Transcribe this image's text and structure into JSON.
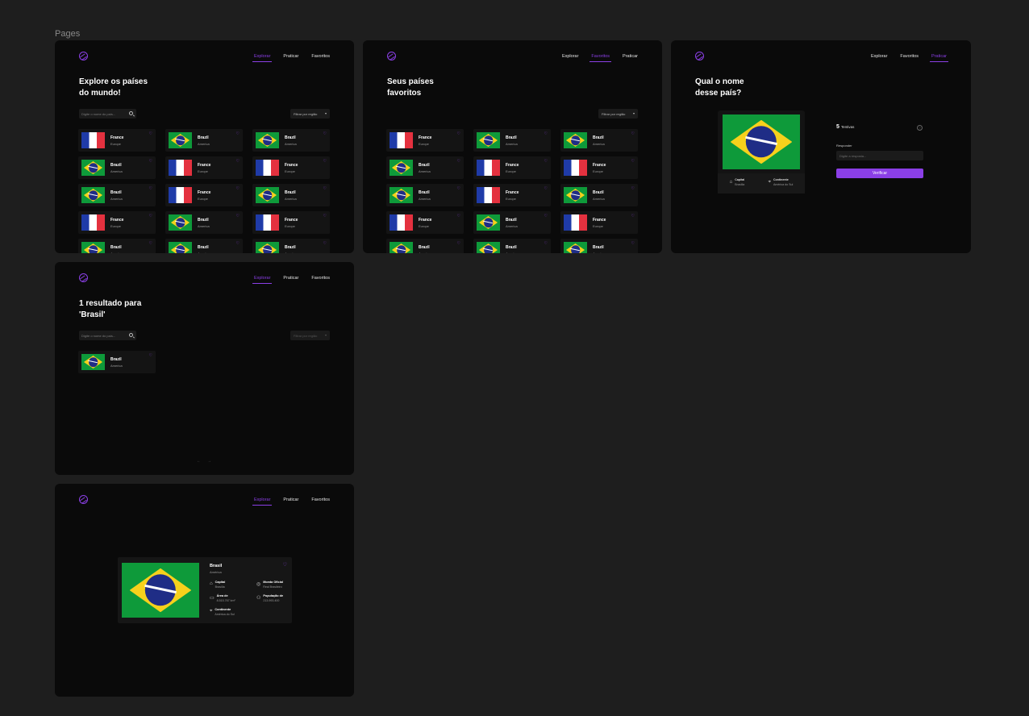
{
  "canvas": {
    "title": "Pages"
  },
  "frames": {
    "explore": {
      "nav": {
        "explore": "Explorar",
        "practice": "Praticar",
        "favorites": "Favoritos"
      },
      "heading_line1": "Explore os países",
      "heading_line2": "do mundo!",
      "search_placeholder": "Digite o nome do país...",
      "filter_label": "Filtrar por região",
      "cards": [
        {
          "name": "France",
          "region": "Europe",
          "flag": "fr"
        },
        {
          "name": "Brazil",
          "region": "America",
          "flag": "br"
        },
        {
          "name": "Brazil",
          "region": "America",
          "flag": "br"
        },
        {
          "name": "Brazil",
          "region": "America",
          "flag": "br"
        },
        {
          "name": "France",
          "region": "Europe",
          "flag": "fr"
        },
        {
          "name": "France",
          "region": "Europe",
          "flag": "fr"
        },
        {
          "name": "Brazil",
          "region": "America",
          "flag": "br"
        },
        {
          "name": "France",
          "region": "Europe",
          "flag": "fr"
        },
        {
          "name": "Brazil",
          "region": "America",
          "flag": "br"
        },
        {
          "name": "France",
          "region": "Europe",
          "flag": "fr"
        },
        {
          "name": "Brazil",
          "region": "America",
          "flag": "br"
        },
        {
          "name": "France",
          "region": "Europe",
          "flag": "fr"
        },
        {
          "name": "Brazil",
          "region": "America",
          "flag": "br"
        },
        {
          "name": "Brazil",
          "region": "America",
          "flag": "br"
        },
        {
          "name": "Brazil",
          "region": "America",
          "flag": "br"
        }
      ]
    },
    "favorites": {
      "nav": {
        "explore": "Explorar",
        "favorites": "Favoritos",
        "practice": "Praticar"
      },
      "heading_line1": "Seus países",
      "heading_line2": "favoritos",
      "filter_label": "Filtrar por região",
      "cards": [
        {
          "name": "France",
          "region": "Europe",
          "flag": "fr"
        },
        {
          "name": "Brazil",
          "region": "America",
          "flag": "br"
        },
        {
          "name": "Brazil",
          "region": "America",
          "flag": "br"
        },
        {
          "name": "Brazil",
          "region": "America",
          "flag": "br"
        },
        {
          "name": "France",
          "region": "Europe",
          "flag": "fr"
        },
        {
          "name": "France",
          "region": "Europe",
          "flag": "fr"
        },
        {
          "name": "Brazil",
          "region": "America",
          "flag": "br"
        },
        {
          "name": "France",
          "region": "Europe",
          "flag": "fr"
        },
        {
          "name": "Brazil",
          "region": "America",
          "flag": "br"
        },
        {
          "name": "France",
          "region": "Europe",
          "flag": "fr"
        },
        {
          "name": "Brazil",
          "region": "America",
          "flag": "br"
        },
        {
          "name": "France",
          "region": "Europe",
          "flag": "fr"
        },
        {
          "name": "Brazil",
          "region": "America",
          "flag": "br"
        },
        {
          "name": "Brazil",
          "region": "America",
          "flag": "br"
        },
        {
          "name": "Brazil",
          "region": "America",
          "flag": "br"
        }
      ]
    },
    "quiz": {
      "nav": {
        "explore": "Explorar",
        "favorites": "Favoritos",
        "practice": "Praticar"
      },
      "heading_line1": "Qual o nome",
      "heading_line2": "desse país?",
      "capital_label": "Capital",
      "capital_value": "Brasília",
      "continent_label": "Continente",
      "continent_value": "América do Sul",
      "attempts_count": "5",
      "attempts_label": "Tentivas",
      "answer_label": "Responder",
      "answer_placeholder": "Digite a resposta...",
      "verify_button": "Verificar"
    },
    "search_result": {
      "nav": {
        "explore": "Explorar",
        "practice": "Praticar",
        "favorites": "Favoritos"
      },
      "heading_line1": "1 resultado para",
      "heading_line2": "'Brasil'",
      "search_placeholder": "Digite o nome do país...",
      "filter_label": "Filtrar por região",
      "card": {
        "name": "Brazil",
        "region": "America",
        "flag": "br"
      },
      "prev": "←",
      "next": "→"
    },
    "detail": {
      "nav": {
        "explore": "Explorar",
        "practice": "Praticar",
        "favorites": "Favoritos"
      },
      "name": "Brasil",
      "region": "América",
      "capital_label": "Capital",
      "capital_value": "Brasília",
      "currency_label": "Moeda Oficial",
      "currency_value": "Real Brasileiro",
      "area_label": "Área de",
      "area_value": "8.515.767 km²",
      "population_label": "População de",
      "population_value": "213.993.400",
      "continent_label": "Continente",
      "continent_value": "América do Sul"
    }
  },
  "colors": {
    "accent": "#8b3fe6",
    "frame_bg": "#0a0a0a",
    "canvas_bg": "#1e1e1e",
    "card_bg": "#141414"
  },
  "icons": [
    "globe-icon",
    "search-icon",
    "heart-icon",
    "chevron-down-icon",
    "home-icon",
    "map-pin-icon",
    "help-circle-icon",
    "currency-icon",
    "area-icon",
    "population-icon"
  ]
}
